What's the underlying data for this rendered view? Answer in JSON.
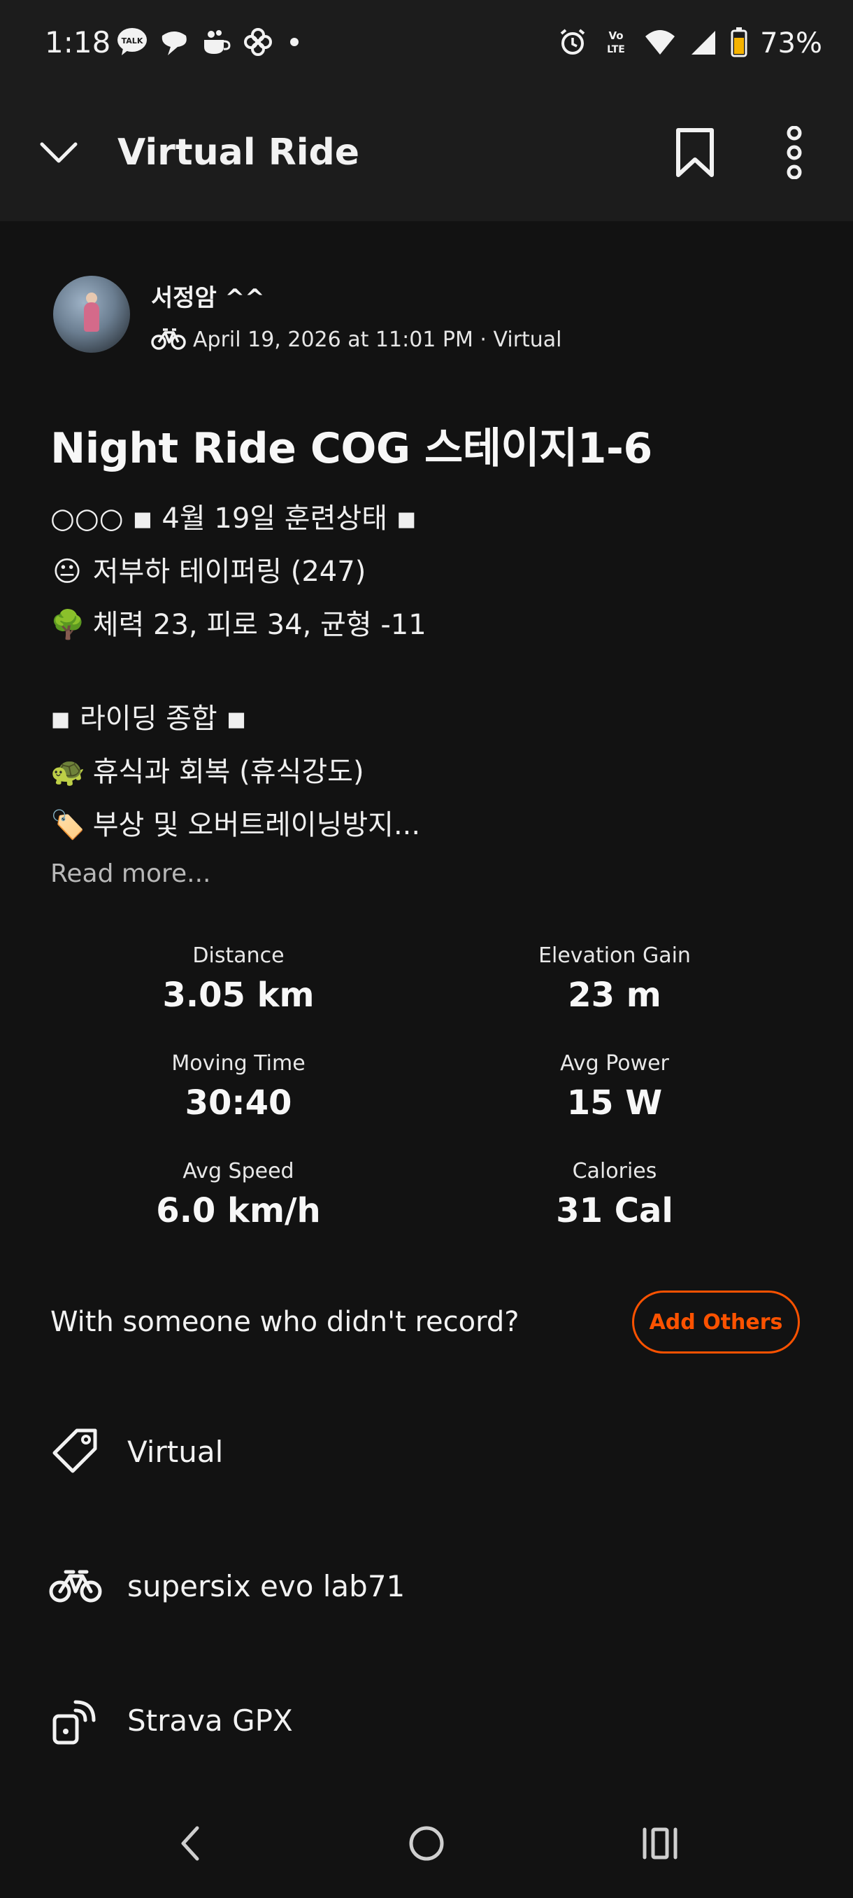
{
  "status_bar": {
    "time": "1:18",
    "battery": "73%",
    "left_icons": [
      "talk-icon",
      "chat-bubble-icon",
      "cup-icon",
      "pinwheel-icon",
      "dot-icon"
    ],
    "right_icons": [
      "alarm-icon",
      "volte-icon",
      "wifi-icon",
      "signal-icon",
      "battery-icon"
    ]
  },
  "app_bar": {
    "title": "Virtual Ride",
    "back_icon": "chevron-down-icon",
    "actions": [
      "bookmark-icon",
      "more-vert-icon"
    ]
  },
  "post": {
    "user_name": "서정암 ^^",
    "meta": "April 19, 2026 at 11:01 PM · Virtual",
    "title": "Night Ride COG 스테이지1-6",
    "description_lines": [
      {
        "emoji": "",
        "text": "○○○ ◾ 4월 19일 훈련상태 ◾"
      },
      {
        "emoji": "😐",
        "text": "저부하 테이퍼링 (247)"
      },
      {
        "emoji": "🌳",
        "text": "체력 23, 피로 34, 균형 -11"
      },
      {
        "emoji": "",
        "text": "◾ 라이딩 종합 ◾"
      },
      {
        "emoji": "🐢",
        "text": "휴식과 회복 (휴식강도)"
      },
      {
        "emoji": "🏷️",
        "text": "부상 및 오버트레이닝방지..."
      }
    ],
    "read_more": "Read more..."
  },
  "stats": [
    {
      "label": "Distance",
      "value": "3.05 km"
    },
    {
      "label": "Elevation Gain",
      "value": "23 m"
    },
    {
      "label": "Moving Time",
      "value": "30:40"
    },
    {
      "label": "Avg Power",
      "value": "15 W"
    },
    {
      "label": "Avg Speed",
      "value": "6.0 km/h"
    },
    {
      "label": "Calories",
      "value": "31 Cal"
    }
  ],
  "with_others": {
    "prompt": "With someone who didn't record?",
    "button": "Add Others"
  },
  "details": [
    {
      "icon": "tag-icon",
      "label": "Virtual"
    },
    {
      "icon": "bike-icon",
      "label": "supersix evo lab71"
    },
    {
      "icon": "device-sync-icon",
      "label": "Strava GPX"
    }
  ],
  "colors": {
    "background": "#121212",
    "app_bar": "#1c1c1c",
    "accent": "#fc5200"
  }
}
